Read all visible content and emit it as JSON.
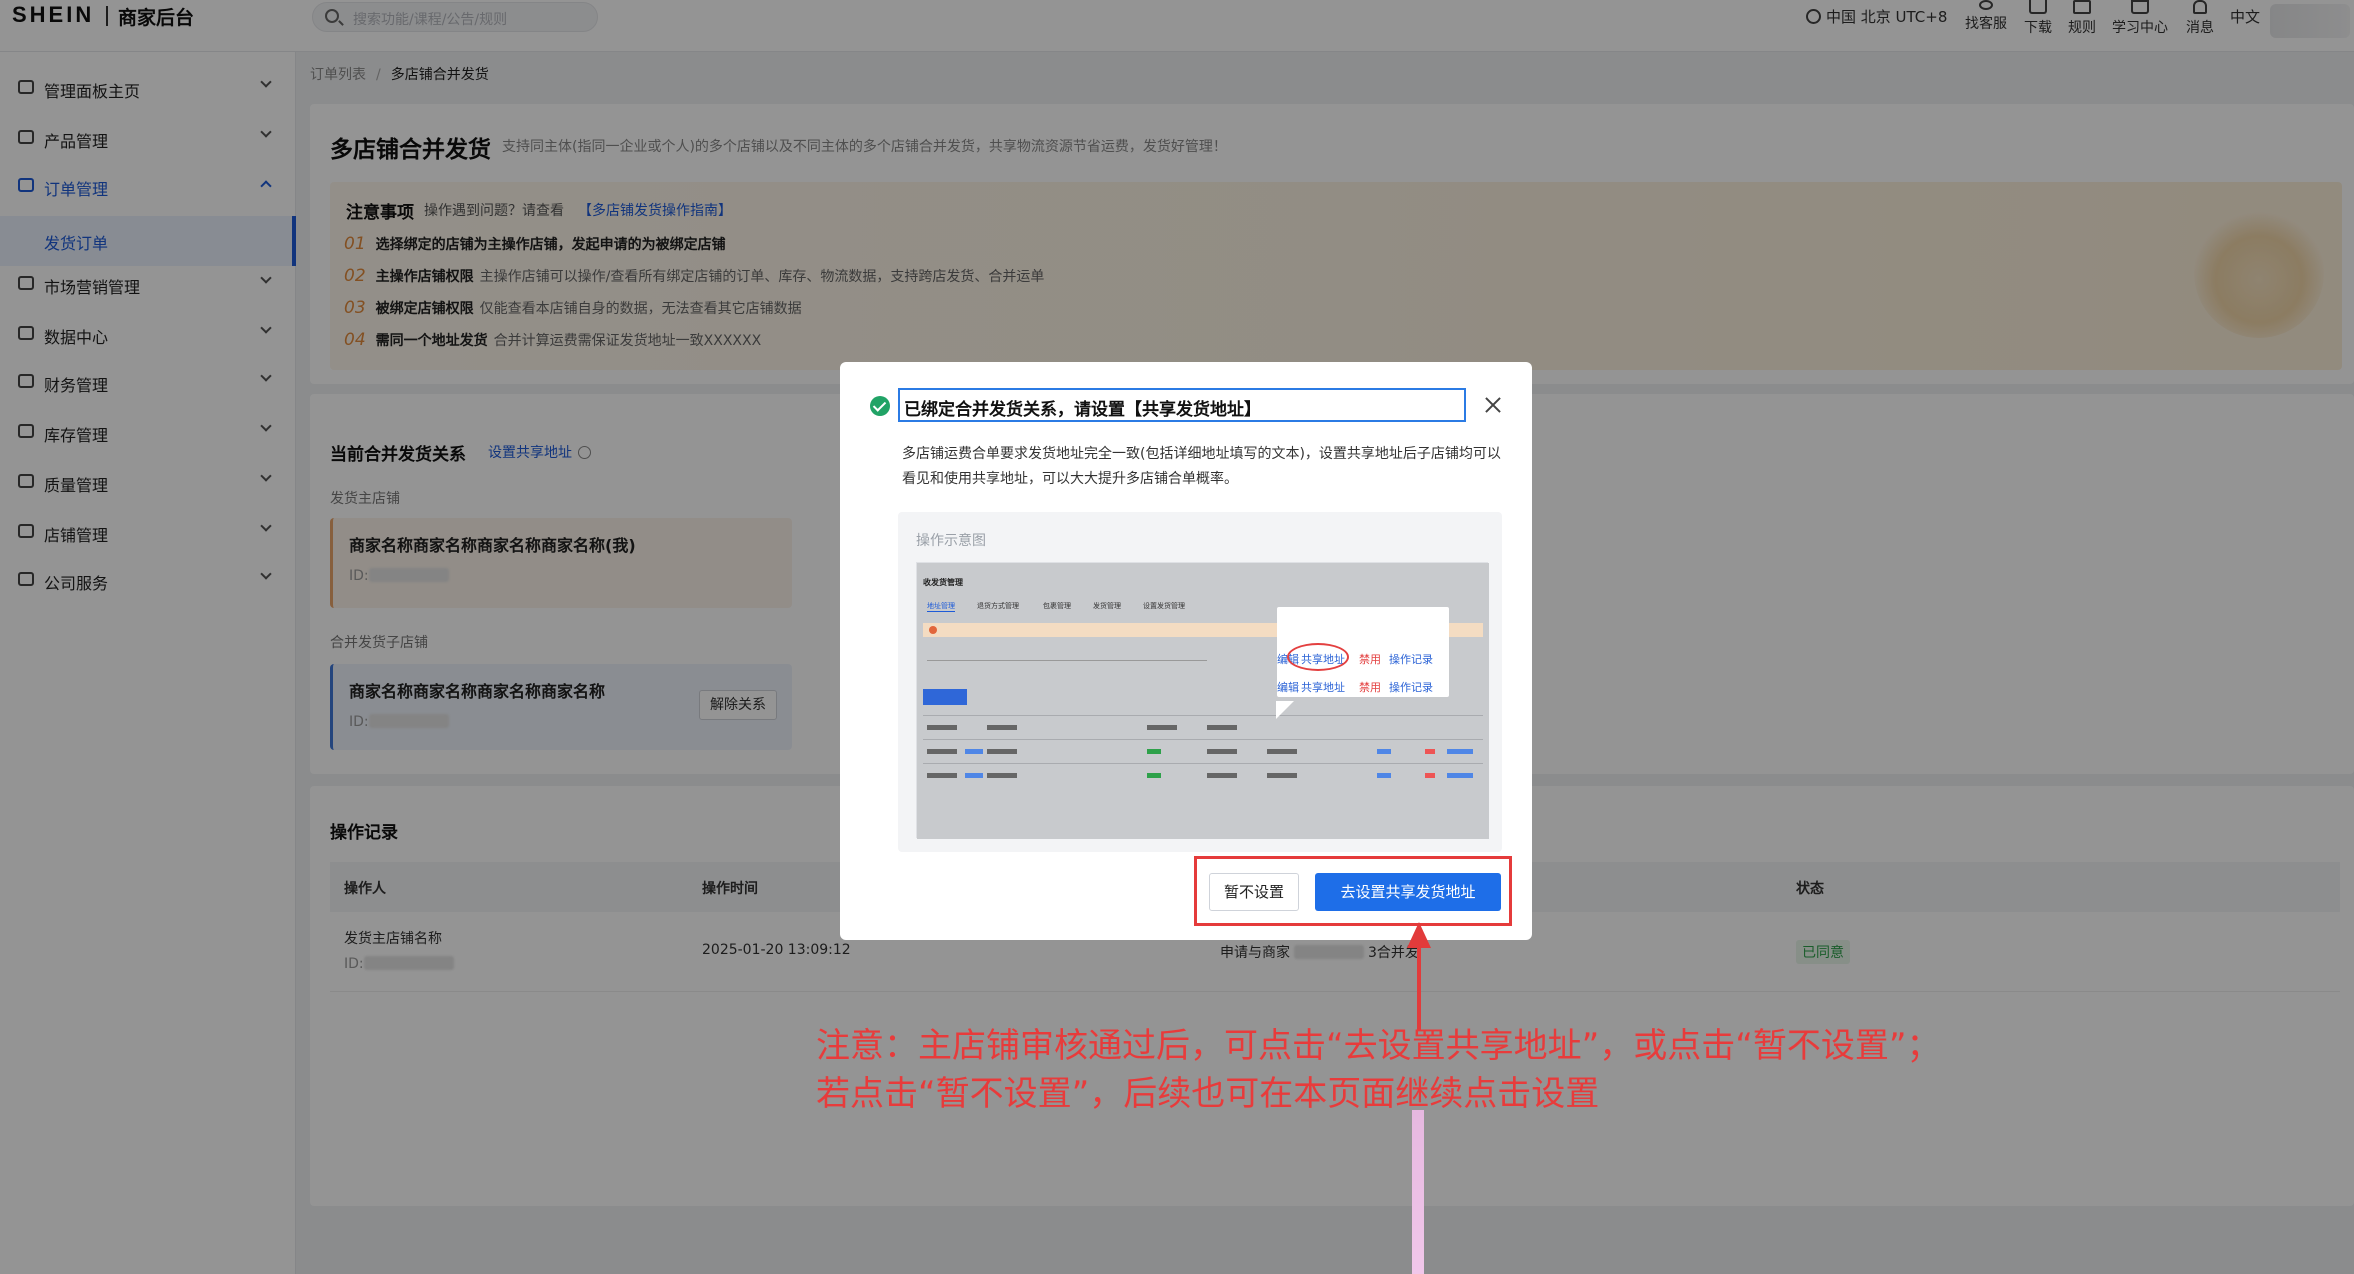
{
  "brand": {
    "logo": "SHEIN",
    "subtitle": "商家后台"
  },
  "search": {
    "placeholder": "搜索功能/课程/公告/规则"
  },
  "topbar": {
    "timezone": "中国 北京 UTC+8",
    "tools": [
      "找客服",
      "下载",
      "规则",
      "学习中心",
      "消息"
    ],
    "language": "中文"
  },
  "sidebar": {
    "items": [
      {
        "label": "管理面板主页",
        "icon": "monitor-icon"
      },
      {
        "label": "产品管理",
        "icon": "box-icon"
      },
      {
        "label": "订单管理",
        "icon": "order-icon"
      },
      {
        "label": "市场营销管理",
        "icon": "marketing-icon"
      },
      {
        "label": "数据中心",
        "icon": "data-icon"
      },
      {
        "label": "财务管理",
        "icon": "wallet-icon"
      },
      {
        "label": "库存管理",
        "icon": "warehouse-icon"
      },
      {
        "label": "质量管理",
        "icon": "shield-icon"
      },
      {
        "label": "店铺管理",
        "icon": "store-icon"
      },
      {
        "label": "公司服务",
        "icon": "service-icon"
      }
    ],
    "active_sub": "发货订单"
  },
  "breadcrumb": {
    "parent": "订单列表",
    "current": "多店铺合并发货"
  },
  "page": {
    "title": "多店铺合并发货",
    "desc": "支持同主体(指同一企业或个人)的多个店铺以及不同主体的多个店铺合并发货，共享物流资源节省运费，发货好管理！"
  },
  "notice": {
    "title": "注意事项",
    "help": "操作遇到问题？请查看",
    "link": "【多店铺发货操作指南】",
    "rows": [
      {
        "num": "01",
        "bold": "选择绑定的店铺为主操作店铺，发起申请的为被绑定店铺",
        "text": ""
      },
      {
        "num": "02",
        "bold": "主操作店铺权限",
        "text": "主操作店铺可以操作/查看所有绑定店铺的订单、库存、物流数据，支持跨店发货、合并运单"
      },
      {
        "num": "03",
        "bold": "被绑定店铺权限",
        "text": "仅能查看本店铺自身的数据，无法查看其它店铺数据"
      },
      {
        "num": "04",
        "bold": "需同一个地址发货",
        "text": "合并计算运费需保证发货地址一致XXXXXX"
      }
    ]
  },
  "relation": {
    "title": "当前合并发货关系",
    "set_link": "设置共享地址",
    "main_label": "发货主店铺",
    "main_shop": "商家名称商家名称商家名称商家名称(我)",
    "sub_label": "合并发货子店铺",
    "sub_shop": "商家名称商家名称商家名称商家名称",
    "id_prefix": "ID:",
    "unbind": "解除关系"
  },
  "records": {
    "title": "操作记录",
    "headers": [
      "操作人",
      "操作时间",
      "状态"
    ],
    "row": {
      "operator": "发货主店铺名称",
      "id_prefix": "ID:",
      "time": "2025-01-20 13:09:12",
      "action_a": "申请与商家",
      "action_b": "3合并发",
      "status": "已同意"
    }
  },
  "modal": {
    "title": "已绑定合并发货关系，请设置【共享发货地址】",
    "desc": "多店铺运费合单要求发货地址完全一致(包括详细地址填写的文本)，设置共享地址后子店铺均可以看见和使用共享地址，可以大大提升多店铺合单概率。",
    "demo_label": "操作示意图",
    "demo": {
      "title": "收发货管理",
      "tabs": [
        "地址管理",
        "退货方式管理",
        "包裹管理",
        "发货管理",
        "设置发货管理"
      ],
      "popover": {
        "edit": "编辑",
        "share": "共享地址",
        "disable": "禁用",
        "log": "操作记录"
      }
    },
    "cancel": "暂不设置",
    "confirm": "去设置共享发货地址"
  },
  "annotation": {
    "line1": "注意：主店铺审核通过后，可点击“去设置共享地址”，或点击“暂不设置”；",
    "line2": "若点击“暂不设置”，后续也可在本页面继续点击设置",
    "color": "#e83b3b"
  },
  "colors": {
    "primary": "#1e6ee8",
    "success": "#21a366",
    "highlight": "#e53b3b"
  }
}
